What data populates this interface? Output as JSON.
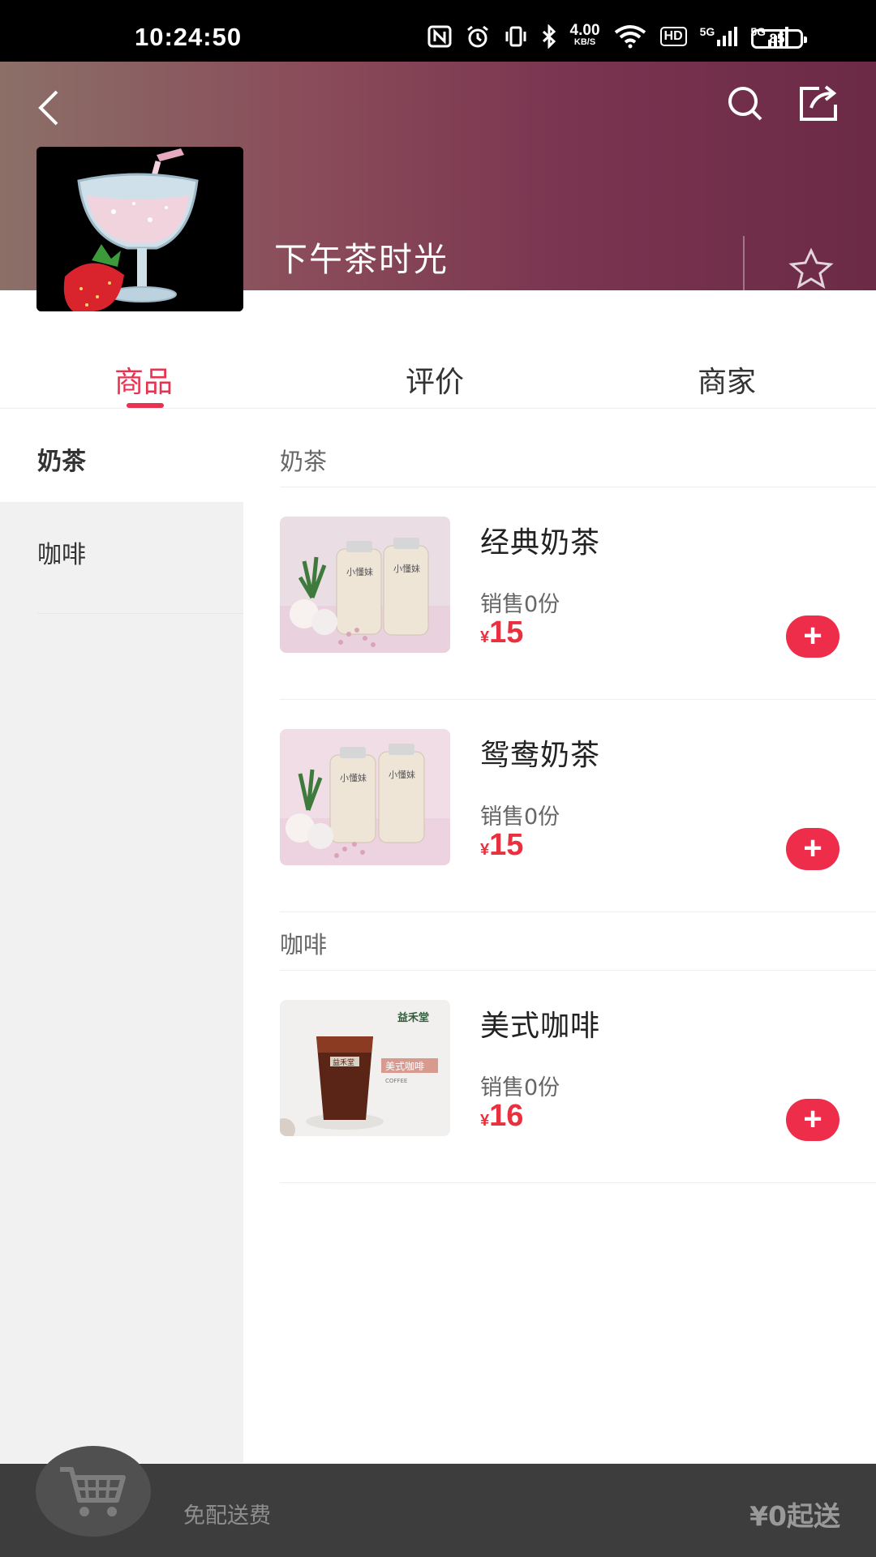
{
  "status_bar": {
    "time": "10:24:50",
    "network_speed": "4.00",
    "network_speed_unit": "KB/S",
    "network_1": "5G",
    "network_2": "5G",
    "hd": "HD",
    "battery": "85",
    "icons": [
      "nfc-icon",
      "alarm-icon",
      "vibrate-icon",
      "bluetooth-icon",
      "wifi-icon",
      "signal-icon"
    ]
  },
  "header": {
    "shop_name": "下午茶时光",
    "favorite_label": "收藏",
    "icons": [
      "back-icon",
      "search-icon",
      "share-icon",
      "star-icon"
    ]
  },
  "tabs": [
    {
      "label": "商品",
      "active": true
    },
    {
      "label": "评价",
      "active": false
    },
    {
      "label": "商家",
      "active": false
    }
  ],
  "sidebar": {
    "items": [
      {
        "label": "奶茶",
        "active": true
      },
      {
        "label": "咖啡",
        "active": false
      }
    ]
  },
  "categories": [
    {
      "name": "奶茶",
      "products": [
        {
          "name": "经典奶茶",
          "sales": "销售0份",
          "currency": "¥",
          "price": "15"
        },
        {
          "name": "鸳鸯奶茶",
          "sales": "销售0份",
          "currency": "¥",
          "price": "15"
        }
      ]
    },
    {
      "name": "咖啡",
      "products": [
        {
          "name": "美式咖啡",
          "sales": "销售0份",
          "currency": "¥",
          "price": "16"
        }
      ]
    }
  ],
  "cart": {
    "delivery_text": "免配送费",
    "min_order": "¥0起送",
    "icon": "cart-icon"
  },
  "colors": {
    "accent": "#e83350",
    "price": "#e8303e",
    "cart_bar": "#3d3d3d"
  }
}
